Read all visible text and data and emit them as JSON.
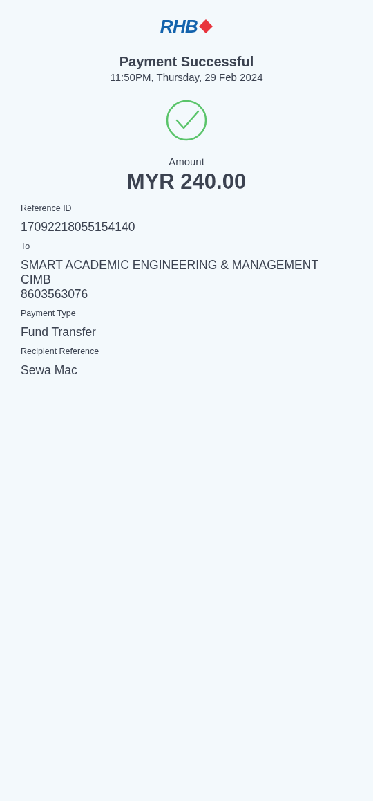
{
  "logo": {
    "text": "RHB"
  },
  "status": {
    "title": "Payment Successful",
    "datetime": "11:50PM, Thursday, 29 Feb 2024"
  },
  "amount": {
    "label": "Amount",
    "value": "MYR 240.00"
  },
  "details": [
    {
      "label": "Reference ID",
      "lines": [
        "17092218055154140"
      ]
    },
    {
      "label": "To",
      "lines": [
        "SMART ACADEMIC ENGINEERING & MANAGEMENT",
        "CIMB",
        "8603563076"
      ]
    },
    {
      "label": "Payment Type",
      "lines": [
        "Fund Transfer"
      ]
    },
    {
      "label": "Recipient Reference",
      "lines": [
        "Sewa Mac"
      ]
    }
  ]
}
